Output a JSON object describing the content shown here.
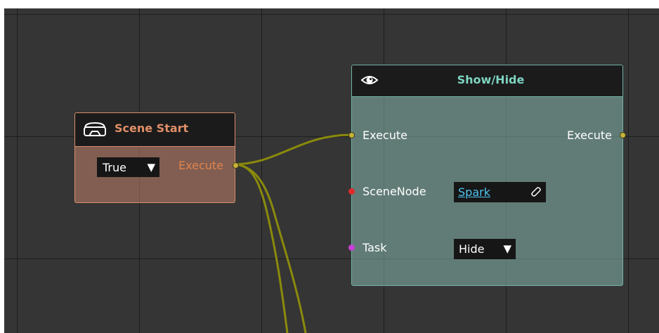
{
  "scene_start_node": {
    "title": "Scene Start",
    "icon": "vr-headset-icon",
    "dropdown_value": "True",
    "dropdown_arrow": "▼",
    "output_label": "Execute",
    "accent_color": "#e08e68"
  },
  "show_hide_node": {
    "title": "Show/Hide",
    "icon": "eye-icon",
    "execute_in_label": "Execute",
    "execute_out_label": "Execute",
    "scenenode_label": "SceneNode",
    "scenenode_value": "Spark",
    "scenenode_link_icon": "paperclip-icon",
    "task_label": "Task",
    "task_value": "Hide",
    "task_arrow": "▼",
    "accent_color": "#7dd3c1"
  },
  "colors": {
    "canvas_background": "#353535",
    "grid_line": "#1e1e1e",
    "wire": "#8a8a0c",
    "exec_pin": "#c7b23a",
    "scenenode_pin": "#e02a2a",
    "task_pin": "#c640d8",
    "link_text": "#4ec3f0"
  }
}
